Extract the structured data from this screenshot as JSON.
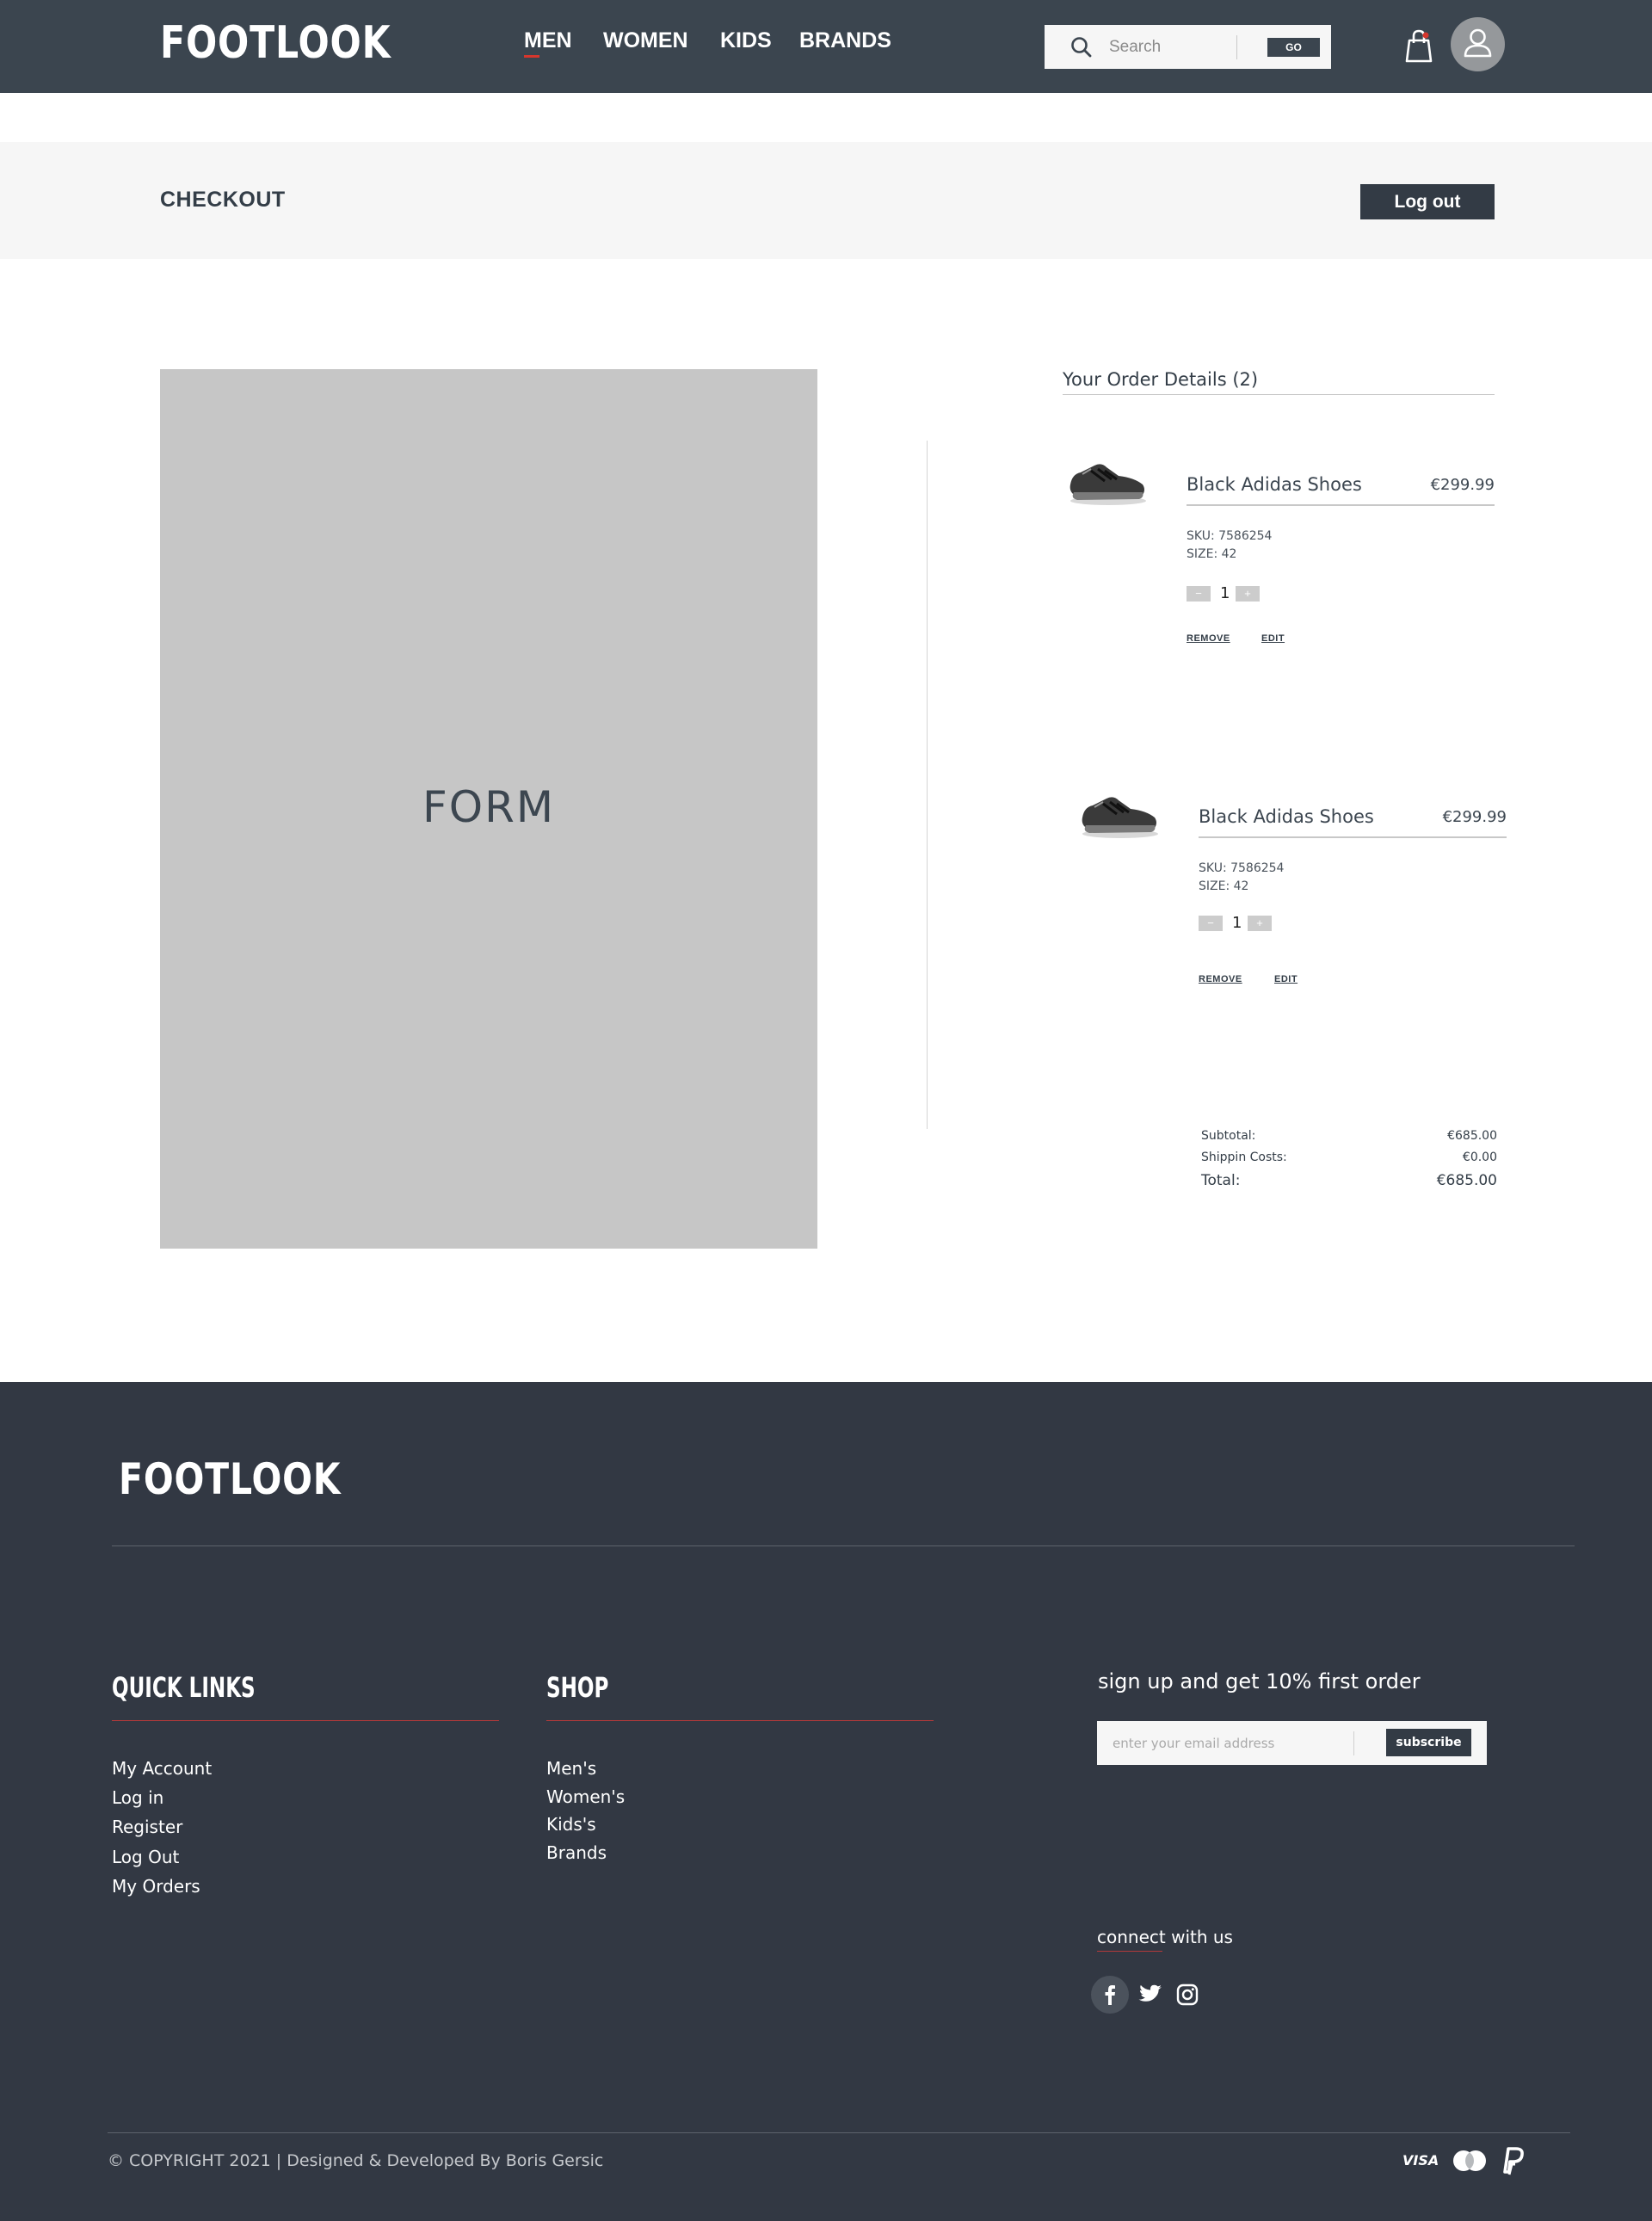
{
  "header": {
    "logo": "FOOTLOOK",
    "nav": [
      {
        "label": "MEN"
      },
      {
        "label": "WOMEN"
      },
      {
        "label": "KIDS"
      },
      {
        "label": "BRANDS"
      }
    ],
    "search": {
      "placeholder": "Search",
      "button_label": "GO"
    },
    "icons": {
      "search": "search-icon",
      "bag": "shopping-bag-icon",
      "user": "user-avatar-icon"
    }
  },
  "checkout": {
    "title": "CHECKOUT",
    "logout_label": "Log out"
  },
  "form_placeholder": "FORM",
  "order": {
    "title": "Your Order Details (2)",
    "items": [
      {
        "name": "Black Adidas Shoes",
        "price": "€299.99",
        "sku": "SKU: 7586254",
        "size": "SIZE: 42",
        "quantity": "1",
        "remove_label": "REMOVE",
        "edit_label": "EDIT"
      },
      {
        "name": "Black Adidas Shoes",
        "price": "€299.99",
        "sku": "SKU: 7586254",
        "size": "SIZE: 42",
        "quantity": "1",
        "remove_label": "REMOVE",
        "edit_label": "EDIT"
      }
    ],
    "summary": {
      "subtotal_label": "Subtotal:",
      "subtotal": "€685.00",
      "shipping_label": "Shippin Costs:",
      "shipping": "€0.00",
      "total_label": "Total:",
      "total": "€685.00"
    }
  },
  "footer": {
    "logo": "FOOTLOOK",
    "quick_links": {
      "heading": "QUICK LINKS",
      "items": [
        "My Account",
        "Log in",
        "Register",
        "Log Out",
        "My Orders"
      ]
    },
    "shop": {
      "heading": "SHOP",
      "items": [
        "Men's",
        "Women's",
        "Kids's",
        "Brands"
      ]
    },
    "newsletter": {
      "heading": "sign up and get 10% first order",
      "placeholder": "enter your email address",
      "button_label": "subscribe"
    },
    "connect_label": "connect with us",
    "social": [
      "facebook-icon",
      "twitter-icon",
      "instagram-icon"
    ],
    "copyright": "© COPYRIGHT 2021 | Designed & Developed By Boris Gersic",
    "payment": [
      "visa-icon",
      "mastercard-icon",
      "paypal-icon"
    ]
  },
  "colors": {
    "header_bg": "#3b454f",
    "footer_bg": "#323843",
    "accent_red": "#d6362d",
    "form_bg": "#c6c6c6"
  }
}
